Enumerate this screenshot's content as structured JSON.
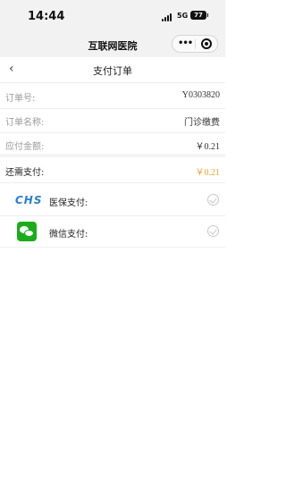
{
  "status_bar": {
    "time": "14:44",
    "network": "5G",
    "battery": "77"
  },
  "app_bar": {
    "title": "互联网医院"
  },
  "page": {
    "title": "支付订单"
  },
  "order": [
    {
      "label": "订单号:",
      "value": "Y0303820"
    },
    {
      "label": "订单名称:",
      "value": "门诊缴费"
    },
    {
      "label": "应付金额:",
      "value": "￥0.21"
    }
  ],
  "amount_due": {
    "label": "还需支付:",
    "value": "￥0.21"
  },
  "payment_methods": [
    {
      "label": "医保支付:",
      "logo_text": "CHS",
      "icon": "chs-logo-icon"
    },
    {
      "label": "微信支付:",
      "icon": "wechat-icon"
    }
  ],
  "colors": {
    "accent": "#f3a12a",
    "chs_blue": "#2a7fd6",
    "wechat_green": "#1aad19"
  }
}
